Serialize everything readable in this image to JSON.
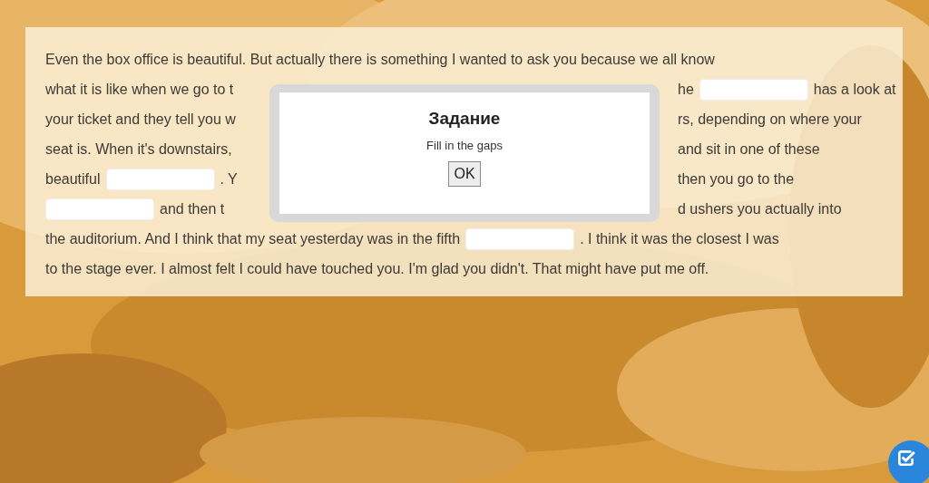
{
  "passage": {
    "lines": [
      {
        "left": [
          {
            "kind": "text",
            "text": "Even the box office is beautiful. But actually there is something I wanted to ask you because we all know"
          }
        ]
      },
      {
        "left": [
          {
            "kind": "text",
            "text": "what it is like when we go to t"
          }
        ],
        "right": [
          {
            "kind": "text",
            "text": "he"
          },
          {
            "kind": "gap"
          },
          {
            "kind": "text",
            "text": "has a look at"
          }
        ]
      },
      {
        "left": [
          {
            "kind": "text",
            "text": "your ticket and they tell you w"
          }
        ],
        "right": [
          {
            "kind": "text",
            "text": "rs, depending on where your"
          }
        ]
      },
      {
        "left": [
          {
            "kind": "text",
            "text": "seat is. When it's downstairs,"
          }
        ],
        "right": [
          {
            "kind": "text",
            "text": "and sit in one of these"
          }
        ]
      },
      {
        "left": [
          {
            "kind": "text",
            "text": "beautiful"
          },
          {
            "kind": "gap"
          },
          {
            "kind": "text",
            "text": ". Y"
          }
        ],
        "right": [
          {
            "kind": "text",
            "text": "then you go to the"
          }
        ]
      },
      {
        "left": [
          {
            "kind": "gap"
          },
          {
            "kind": "text",
            "text": "and then t"
          }
        ],
        "right": [
          {
            "kind": "text",
            "text": "d ushers you actually into"
          }
        ]
      },
      {
        "left": [
          {
            "kind": "text",
            "text": "the auditorium. And I think that my seat yesterday was in the fifth"
          },
          {
            "kind": "gap"
          },
          {
            "kind": "text",
            "text": ". I think it was the closest I was"
          }
        ]
      },
      {
        "left": [
          {
            "kind": "text",
            "text": "to the stage ever. I almost felt I could have touched you. I'm glad you didn't. That might have put me off."
          }
        ]
      }
    ]
  },
  "dialog": {
    "title": "Задание",
    "message": "Fill in the gaps",
    "button": "OK"
  }
}
